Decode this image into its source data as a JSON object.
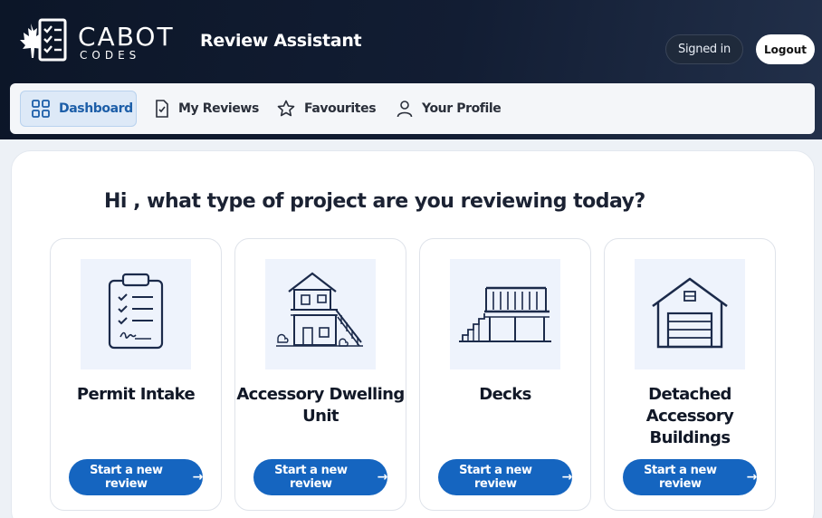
{
  "brand": {
    "name": "CABOT",
    "sub": "CODES",
    "logo_icon": "maple-leaf-checklist-icon"
  },
  "header": {
    "title": "Review Assistant",
    "signed_in_label": "Signed in",
    "logout_label": "Logout"
  },
  "nav": {
    "items": [
      {
        "label": "Dashboard",
        "icon": "dashboard-grid-icon",
        "active": true
      },
      {
        "label": "My Reviews",
        "icon": "document-check-icon",
        "active": false
      },
      {
        "label": "Favourites",
        "icon": "star-icon",
        "active": false
      },
      {
        "label": "Your Profile",
        "icon": "user-icon",
        "active": false
      }
    ]
  },
  "main": {
    "greeting": "Hi , what type of project are you reviewing today?",
    "cards": [
      {
        "title": "Permit Intake",
        "image": "clipboard-checklist-illustration",
        "button": "Start a new review"
      },
      {
        "title": "Accessory Dwelling Unit",
        "image": "two-storey-house-illustration",
        "button": "Start a new review"
      },
      {
        "title": "Decks",
        "image": "deck-with-stairs-illustration",
        "button": "Start a new review"
      },
      {
        "title": "Detached Accessory Buildings",
        "image": "garage-illustration",
        "button": "Start a new review"
      }
    ]
  },
  "colors": {
    "header_bg": "#0c1628",
    "accent": "#1565c0",
    "active_nav_bg": "#dde9f7",
    "card_image_bg": "#eef3fc",
    "line_art": "#1b2a4a"
  }
}
